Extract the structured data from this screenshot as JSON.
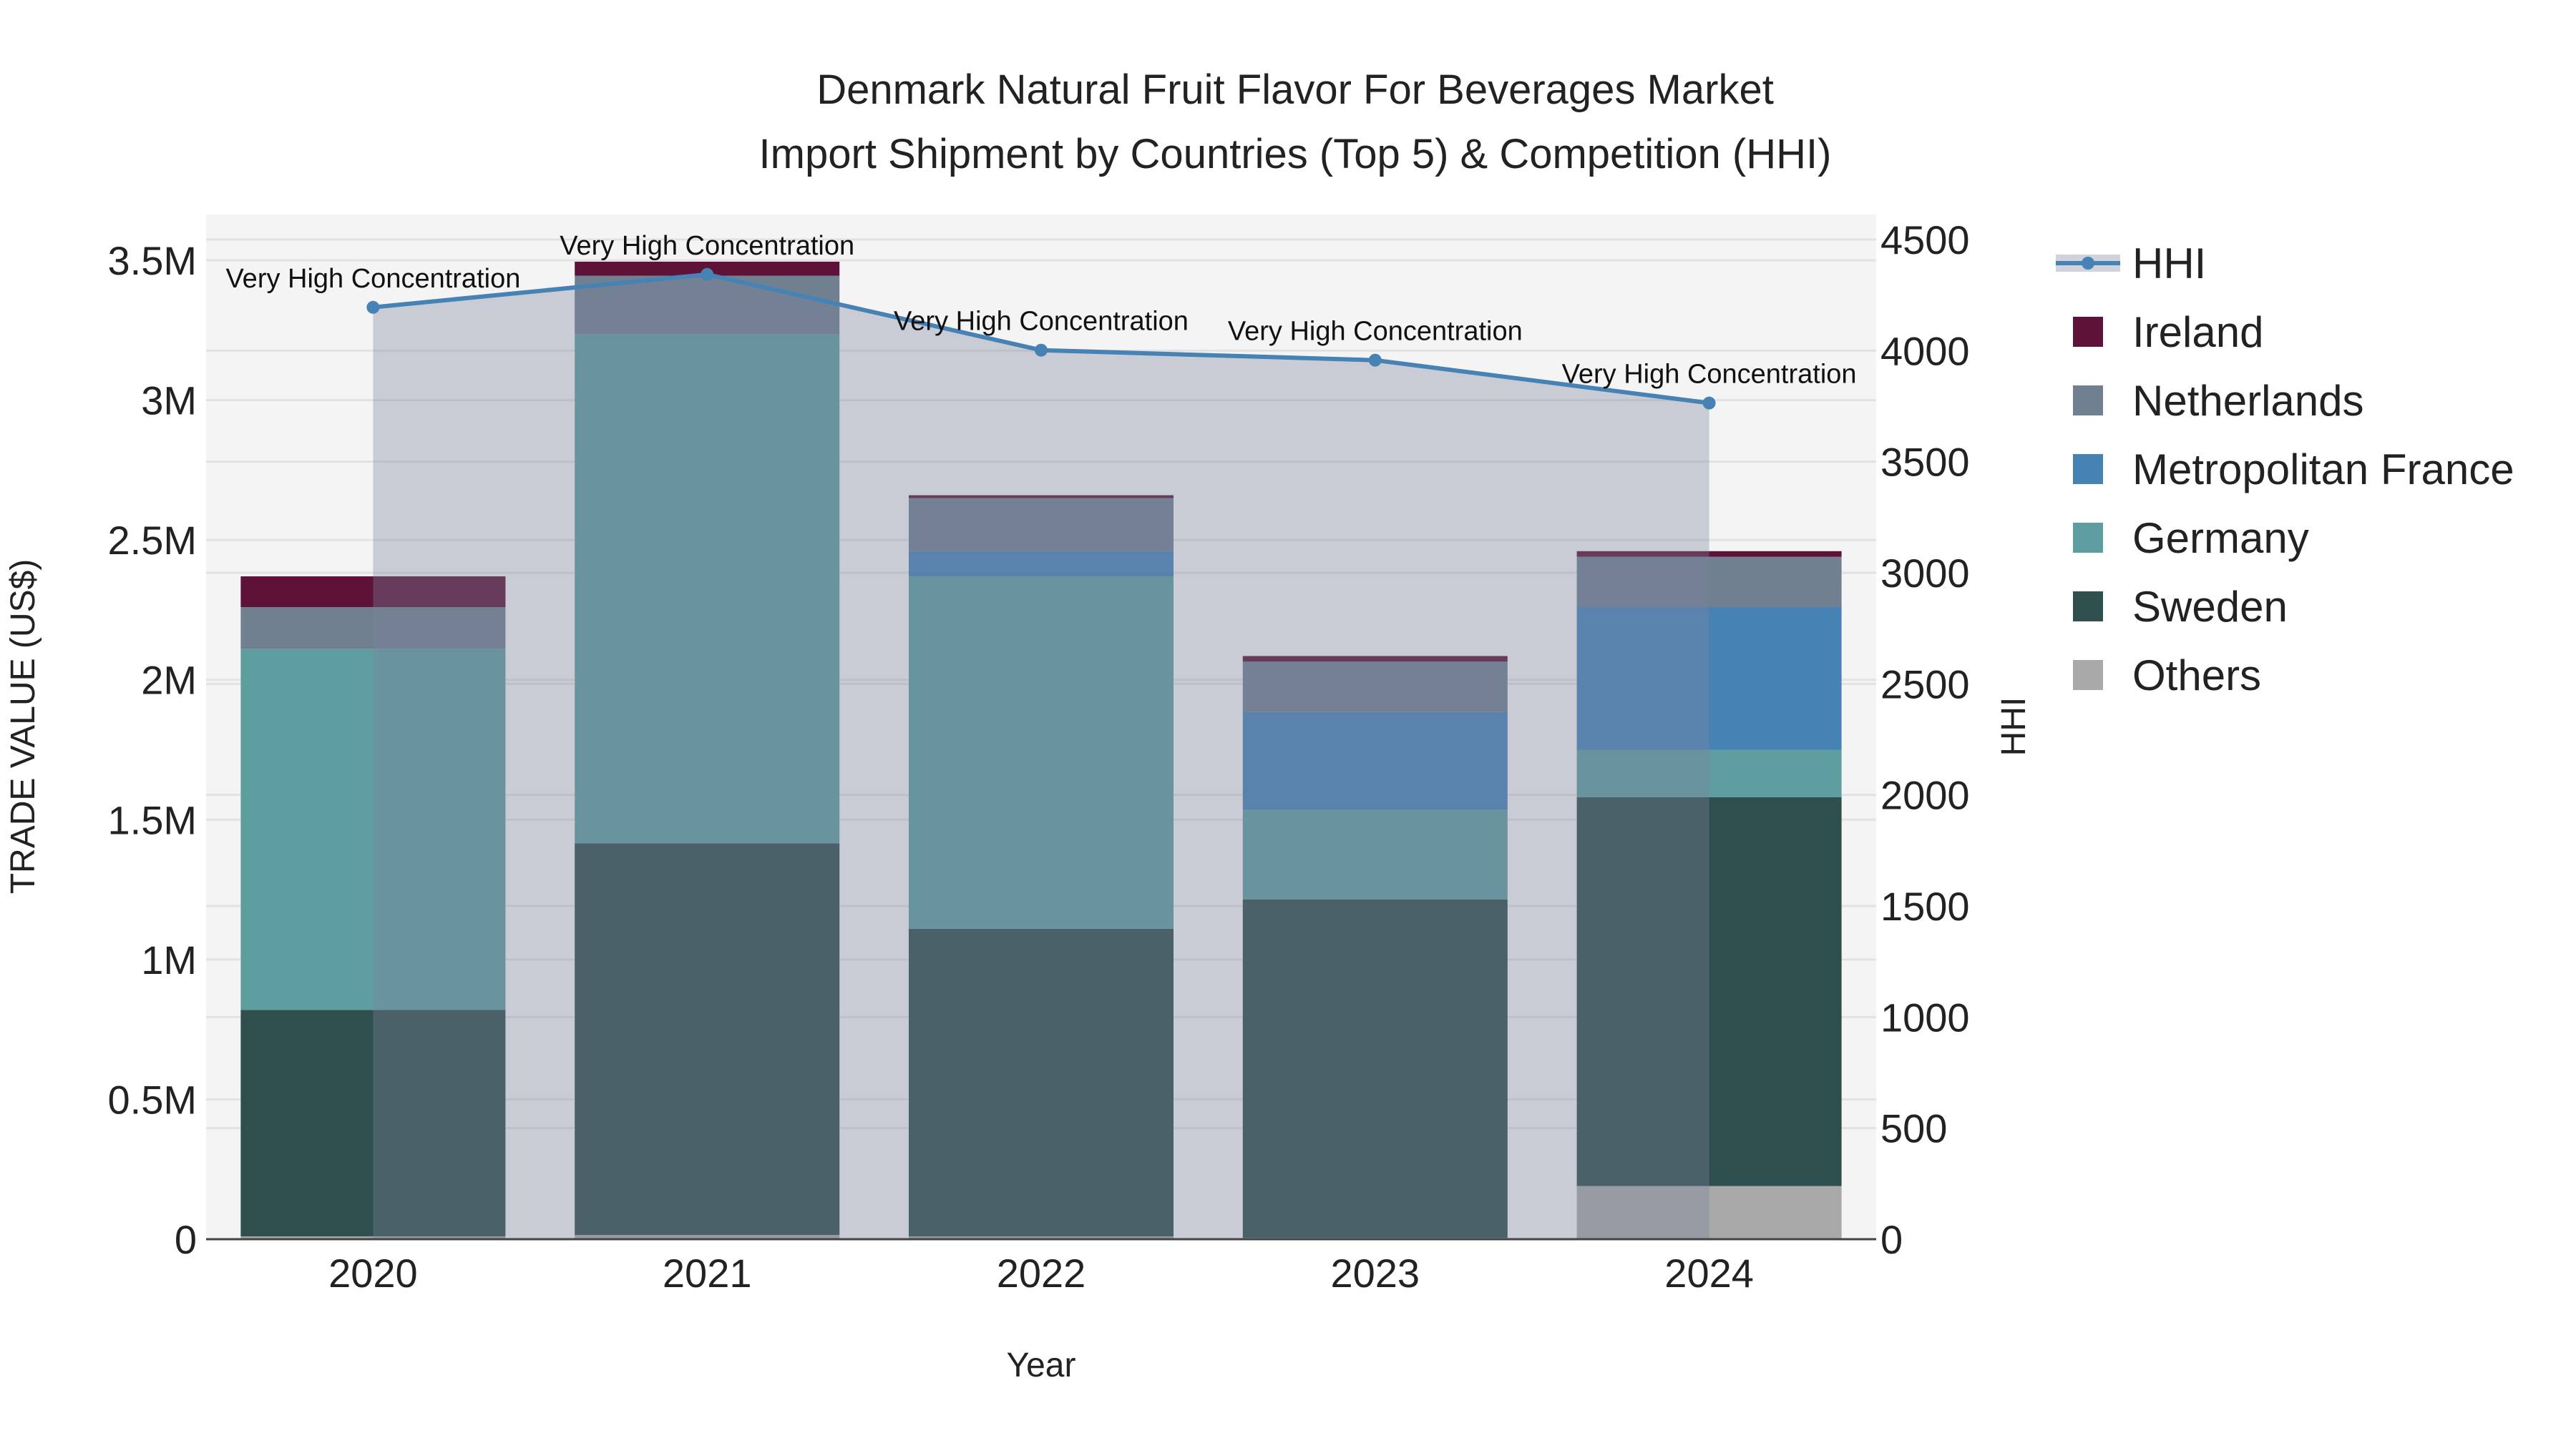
{
  "chart_data": {
    "type": "bar",
    "title_line1": "Denmark Natural Fruit Flavor For Beverages Market",
    "title_line2": "Import Shipment by Countries (Top 5) & Competition (HHI)",
    "xlabel": "Year",
    "ylabel": "TRADE VALUE (US$)",
    "y2label": "HHI",
    "categories": [
      "2020",
      "2021",
      "2022",
      "2023",
      "2024"
    ],
    "ylim": [
      0,
      3650000
    ],
    "y_ticks": [
      0,
      500000,
      1000000,
      1500000,
      2000000,
      2500000,
      3000000,
      3500000
    ],
    "y_tick_labels": [
      "0",
      "0.5M",
      "1M",
      "1.5M",
      "2M",
      "2.5M",
      "3M",
      "3.5M"
    ],
    "y2lim": [
      0,
      4600
    ],
    "y2_ticks": [
      0,
      500,
      1000,
      1500,
      2000,
      2500,
      3000,
      3500,
      4000,
      4500
    ],
    "y2_tick_labels": [
      "0",
      "500",
      "1000",
      "1500",
      "2000",
      "2500",
      "3000",
      "3500",
      "4000",
      "4500"
    ],
    "stack_order": [
      "Others",
      "Sweden",
      "Germany",
      "Metropolitan France",
      "Netherlands",
      "Ireland"
    ],
    "series": [
      {
        "name": "Others",
        "color": "#a9a9a9",
        "values": [
          10000,
          15000,
          10000,
          5000,
          190000
        ]
      },
      {
        "name": "Sweden",
        "color": "#2f4f4f",
        "values": [
          810000,
          1400000,
          1100000,
          1210000,
          1390000
        ]
      },
      {
        "name": "Germany",
        "color": "#5f9ea0",
        "values": [
          1290000,
          1820000,
          1260000,
          320000,
          170000
        ]
      },
      {
        "name": "Metropolitan France",
        "color": "#4682b4",
        "values": [
          0,
          0,
          90000,
          350000,
          510000
        ]
      },
      {
        "name": "Netherlands",
        "color": "#708090",
        "values": [
          150000,
          210000,
          190000,
          180000,
          180000
        ]
      },
      {
        "name": "Ireland",
        "color": "#5e1238",
        "values": [
          110000,
          50000,
          10000,
          20000,
          20000
        ]
      }
    ],
    "hhi": {
      "name": "HHI",
      "color": "#4682b4",
      "values": [
        4195,
        4343,
        4002,
        3957,
        3764
      ]
    },
    "annotations": [
      "Very High Concentration",
      "Very High Concentration",
      "Very High Concentration",
      "Very High Concentration",
      "Very High Concentration"
    ],
    "legend_order": [
      "HHI",
      "Ireland",
      "Netherlands",
      "Metropolitan France",
      "Germany",
      "Sweden",
      "Others"
    ],
    "legend_position": "right",
    "grid": true
  }
}
